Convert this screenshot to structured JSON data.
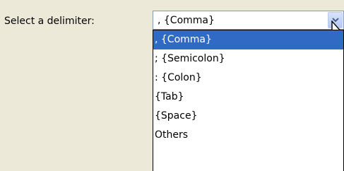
{
  "label": "Select a delimiter:",
  "combo": {
    "value": ", {Comma}",
    "dropdown_icon": "chevron-down-icon"
  },
  "options": [
    ", {Comma}",
    "; {Semicolon}",
    ": {Colon}",
    "{Tab}",
    "{Space}",
    "Others"
  ],
  "selected_index": 0,
  "colors": {
    "background": "#ECE9D8",
    "selection": "#316AC5",
    "selection_text": "#FFFFFF"
  }
}
